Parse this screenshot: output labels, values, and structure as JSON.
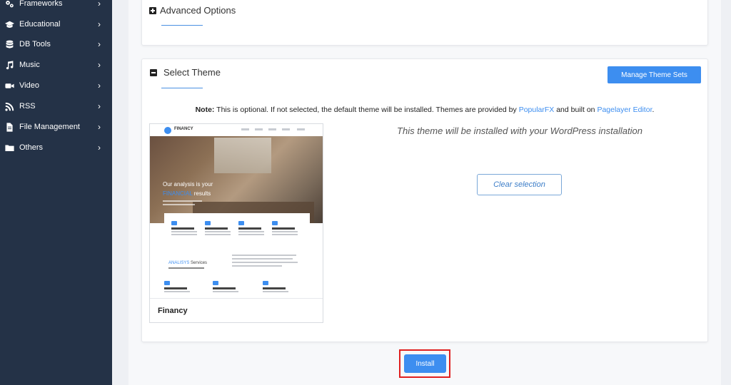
{
  "sidebar": {
    "items": [
      {
        "label": "Frameworks",
        "icon": "gears-icon"
      },
      {
        "label": "Educational",
        "icon": "graduation-cap-icon"
      },
      {
        "label": "DB Tools",
        "icon": "database-icon"
      },
      {
        "label": "Music",
        "icon": "music-note-icon"
      },
      {
        "label": "Video",
        "icon": "video-camera-icon"
      },
      {
        "label": "RSS",
        "icon": "rss-icon"
      },
      {
        "label": "File Management",
        "icon": "file-icon"
      },
      {
        "label": "Others",
        "icon": "folder-icon"
      }
    ]
  },
  "advanced": {
    "title": "Advanced Options"
  },
  "theme": {
    "title": "Select Theme",
    "manage_button": "Manage Theme Sets",
    "note_prefix": "Note:",
    "note_text": " This is optional. If not selected, the default theme will be installed. Themes are provided by ",
    "note_link1": "PopularFX",
    "note_mid": " and built on ",
    "note_link2": "Pagelayer Editor",
    "note_end": ".",
    "caption": "This theme will be installed with your WordPress installation",
    "clear_button": "Clear selection",
    "selected_theme": {
      "name": "Financy",
      "brand": "FINANCY",
      "hero_line1": "Our analysis is your",
      "hero_line2_accent": "FINANCIAL",
      "hero_line2_rest": " results",
      "section_accent": "ANALISYS",
      "section_rest": " Services"
    }
  },
  "install_button": "Install",
  "colors": {
    "sidebar_bg": "#243247",
    "accent": "#3d8ef0",
    "highlight_box": "#e02020"
  }
}
